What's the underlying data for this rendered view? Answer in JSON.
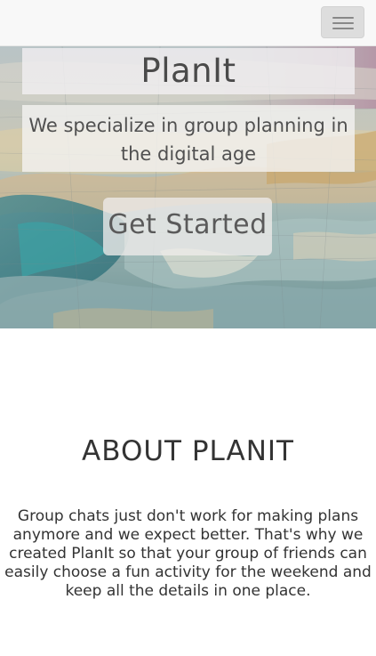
{
  "navbar": {
    "toggle_icon": "hamburger-menu-icon",
    "background": "#f8f8f8"
  },
  "hero": {
    "title": "PlanIt",
    "subtitle": "We specialize in group planning in the digital age",
    "cta_label": "Get Started",
    "background_image": "painted-map-texture"
  },
  "about": {
    "heading": "ABOUT PLANIT",
    "body": "Group chats just don't work for making plans anymore and we expect better. That's why we created PlanIt so that your group of friends can easily choose a fun activity for the weekend and keep all the details in one place."
  },
  "colors": {
    "text_dark": "#333333",
    "overlay_light": "#f0eef0",
    "toggle_bg": "#dddddd",
    "toggle_bar": "#888888"
  }
}
